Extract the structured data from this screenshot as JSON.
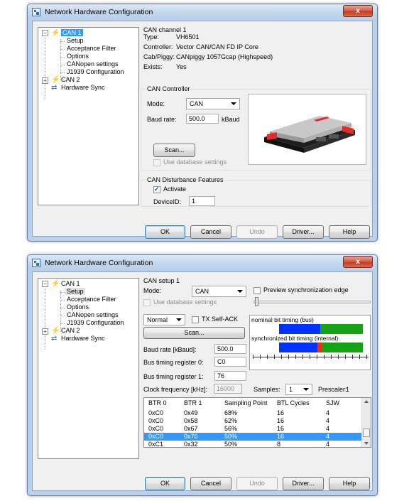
{
  "dialog_top": {
    "title": "Network Hardware Configuration",
    "close_label": "x",
    "tree": [
      {
        "label": "CAN 1"
      },
      {
        "label": "Setup"
      },
      {
        "label": "Acceptance Filter"
      },
      {
        "label": "Options"
      },
      {
        "label": "CANopen settings"
      },
      {
        "label": "J1939 Configuration"
      },
      {
        "label": "CAN 2"
      },
      {
        "label": "Hardware Sync"
      }
    ],
    "channel_title": "CAN channel 1",
    "info": [
      {
        "label": "Type:",
        "value": "VH6501"
      },
      {
        "label": "Controller:",
        "value": "Vector CAN/CAN FD IP Core"
      },
      {
        "label": "Cab/Piggy:",
        "value": "CANpiggy 1057Gcap (Highspeed)"
      },
      {
        "label": "Exists:",
        "value": "Yes"
      }
    ],
    "controller_group": "CAN Controller",
    "mode_label": "Mode:",
    "mode_value": "CAN",
    "baud_label": "Baud rate:",
    "baud_value": "500.0",
    "baud_unit": "kBaud",
    "scan_label": "Scan...",
    "use_db_label": "Use database settings",
    "disturb_group": "CAN Disturbance Features",
    "activate_label": "Activate",
    "deviceid_label": "DeviceID:",
    "deviceid_value": "1",
    "buttons": {
      "ok": "OK",
      "cancel": "Cancel",
      "undo": "Undo",
      "driver": "Driver...",
      "help": "Help"
    }
  },
  "dialog_bottom": {
    "title": "Network Hardware Configuration",
    "close_label": "x",
    "tree": [
      {
        "label": "CAN 1"
      },
      {
        "label": "Setup"
      },
      {
        "label": "Acceptance Filter"
      },
      {
        "label": "Options"
      },
      {
        "label": "CANopen settings"
      },
      {
        "label": "J1939 Configuration"
      },
      {
        "label": "CAN 2"
      },
      {
        "label": "Hardware Sync"
      }
    ],
    "setup_title": "CAN setup 1",
    "mode_label": "Mode:",
    "mode_value": "CAN",
    "preview_label": "Preview synchronization edge",
    "use_db_label": "Use database settings",
    "normal_value": "Normal",
    "tx_self_ack_label": "TX Self-ACK",
    "scan_label": "Scan...",
    "nominal_label": "nominal bit timing (bus)",
    "sync_label": "synchronized bit timing (internal)",
    "baud_label": "Baud rate [kBaud]:",
    "baud_value": "500.0",
    "btr0_label": "Bus timing register 0:",
    "btr0_value": "C0",
    "btr1_label": "Bus timing register 1:",
    "btr1_value": "76",
    "clock_label": "Clock frequency [kHz]:",
    "clock_value": "16000",
    "samples_label": "Samples:",
    "samples_value": "1",
    "prescaler_label": "Prescaler:",
    "prescaler_value": "1",
    "table": {
      "headers": [
        "BTR 0",
        "BTR 1",
        "Sampling Point",
        "BTL Cycles",
        "SJW"
      ],
      "rows": [
        [
          "0xC0",
          "0x49",
          "68%",
          "16",
          "4"
        ],
        [
          "0xC0",
          "0x58",
          "62%",
          "16",
          "4"
        ],
        [
          "0xC0",
          "0x67",
          "56%",
          "16",
          "4"
        ],
        [
          "0xC0",
          "0x76",
          "50%",
          "16",
          "4"
        ],
        [
          "0xC1",
          "0x32",
          "50%",
          "8",
          "4"
        ]
      ]
    },
    "buttons": {
      "ok": "OK",
      "cancel": "Cancel",
      "undo": "Undo",
      "driver": "Driver...",
      "help": "Help"
    }
  },
  "colors": {
    "selection": "#3399ff",
    "timing_blue": "#0033ff",
    "timing_green": "#15a315",
    "timing_red": "#ff2a00"
  }
}
